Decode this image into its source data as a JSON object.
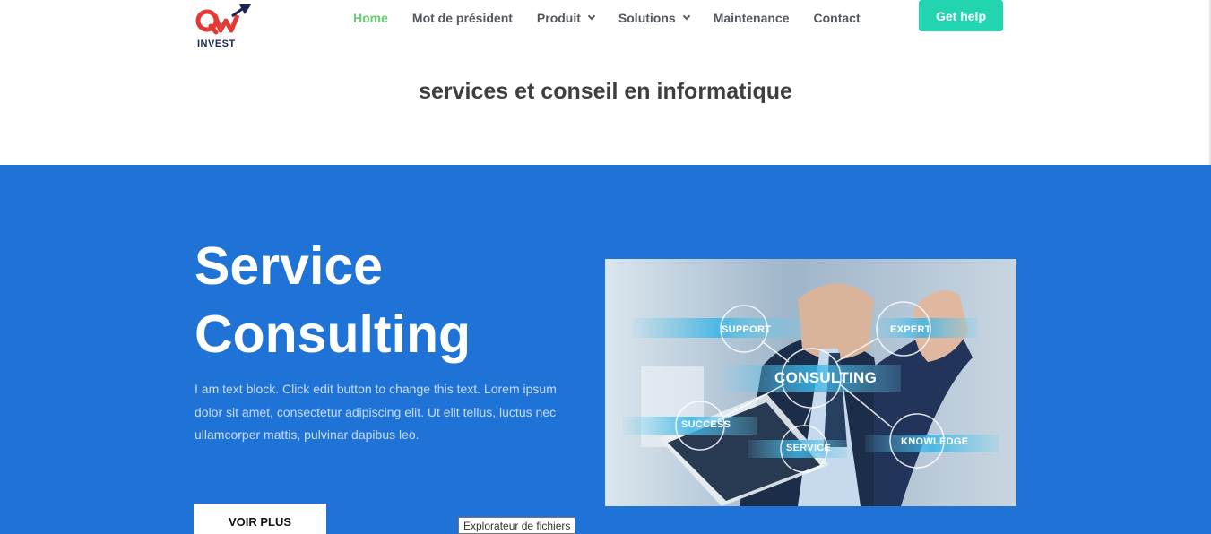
{
  "header": {
    "logo": {
      "mark": "QW",
      "text": "INVEST"
    },
    "nav": [
      {
        "label": "Home",
        "active": true,
        "has_dropdown": false
      },
      {
        "label": "Mot de président",
        "active": false,
        "has_dropdown": false
      },
      {
        "label": "Produit",
        "active": false,
        "has_dropdown": true
      },
      {
        "label": "Solutions",
        "active": false,
        "has_dropdown": true
      },
      {
        "label": "Maintenance",
        "active": false,
        "has_dropdown": false
      },
      {
        "label": "Contact",
        "active": false,
        "has_dropdown": false
      }
    ],
    "cta_label": "Get help"
  },
  "tagline": "services et conseil en informatique",
  "hero": {
    "title_line1": "Service",
    "title_line2": "Consulting",
    "body": "I am text block. Click edit button to change this text. Lorem ipsum dolor sit amet, consectetur adipiscing elit. Ut elit tellus, luctus nec ullamcorper mattis, pulvinar dapibus leo.",
    "button_label": "VOIR PLUS",
    "image_labels": {
      "support": "SUPPORT",
      "expert": "EXPERT",
      "consulting": "CONSULTING",
      "success": "SUCCESS",
      "service": "SERVICE",
      "knowledge": "KNOWLEDGE"
    }
  },
  "tooltip": "Explorateur de fichiers",
  "colors": {
    "nav_active": "#61ce70",
    "nav_text": "#54595f",
    "cta": "#23d4b0",
    "hero_bg": "#1f73d6",
    "logo_red": "#e53935",
    "logo_navy": "#1b2653"
  }
}
